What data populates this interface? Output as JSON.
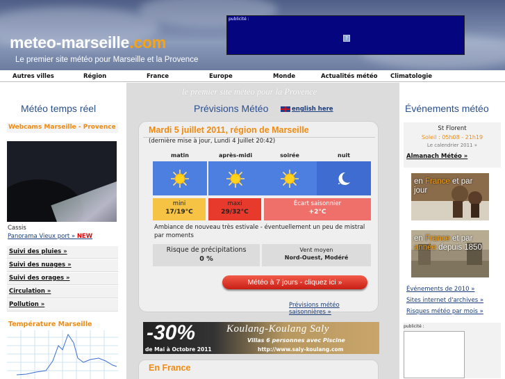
{
  "header": {
    "logo_main": "meteo-marseille",
    "logo_tld": ".com",
    "tagline": "Le premier site météo pour Marseille et la Provence",
    "ad_label": "publicité :",
    "ad_icon": "?"
  },
  "nav": {
    "items": [
      "Autres villes",
      "Région",
      "France",
      "Europe",
      "Monde",
      "Actualités météo",
      "Climatologie"
    ]
  },
  "left": {
    "title": "Météo temps réel",
    "webcam_title": "Webcams Marseille - Provence",
    "webcam_caption": "Cassis",
    "panorama_link": "Panorama Vieux port »",
    "panorama_new": "NEW",
    "links": [
      "Suivi des pluies »",
      "Suivi des nuages »",
      "Suivi des orages »",
      "Circulation »",
      "Pollution »"
    ],
    "temp_title": "Température Marseille"
  },
  "middle": {
    "tagline": "le premier site météo pour la Provence",
    "title": "Prévisions Météo",
    "english_link": "english here",
    "forecast": {
      "title": "Mardi 5 juillet 2011, région de Marseille",
      "update": "(dernière mise à jour, Lundi 4 Juillet 20:42)",
      "periods": [
        "matin",
        "après-midi",
        "soirée",
        "nuit"
      ],
      "icons": [
        "sun-icon",
        "sun-icon",
        "sun-icon",
        "moon-icon"
      ],
      "mini_label": "mini",
      "mini_value": "17/19°C",
      "maxi_label": "maxi",
      "maxi_value": "29/32°C",
      "ecart_label": "Écart saisonnier",
      "ecart_value": "+2°C",
      "ambiance": "Ambiance de nouveau très estivale - éventuellement un peu de mistral par moments",
      "risk_label": "Risque de précipitations",
      "risk_value": "0 %",
      "wind_label": "Vent moyen",
      "wind_value": "Nord-Ouest, Modéré",
      "button": "Météo à 7 jours - cliquez ici »",
      "seasonal_link": "Prévisions météo saisonnières »"
    },
    "banner": {
      "discount": "-30%",
      "line1": "Koulang-Koulang Saly",
      "line2": "Villas 6 personnes avec Piscine",
      "line3": "de Mai à Octobre 2011",
      "line4": "http://www.saly-koulang.com"
    },
    "france_title": "En France"
  },
  "right": {
    "title": "Événements météo",
    "saint": "St Florent",
    "soleil": "Soleil : 05h08 - 21h19",
    "calendar": "Le calendrier 2011 »",
    "almanach": "Almanach Météo »",
    "promo1": {
      "a": "en ",
      "b": "France",
      "c": " et par",
      "d": "jour"
    },
    "promo2": {
      "a": "en ",
      "b": "France",
      "c": " et par",
      "d": "année",
      "e": " depuis 1850"
    },
    "links": [
      "Événements de 2010 »",
      "Sites internet d'archives »",
      "Risques météo par mois »"
    ],
    "ad_label": "publicité :"
  },
  "colors": {
    "accent": "#f08a10",
    "title_blue": "#2a4f8f",
    "sky_blue": "#4c7fe0",
    "red": "#e83a2c"
  }
}
